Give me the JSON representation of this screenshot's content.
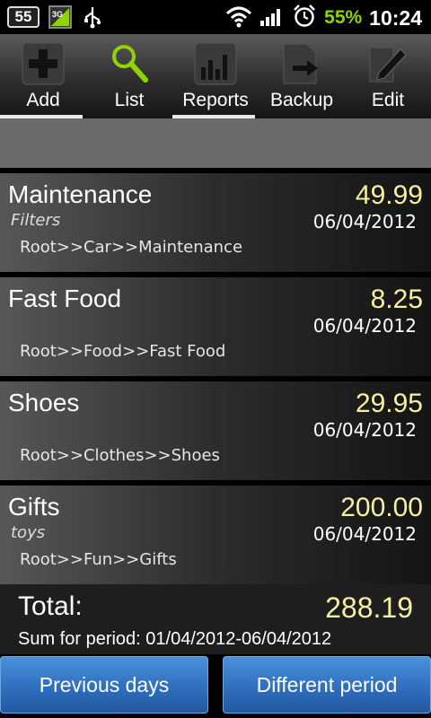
{
  "status_bar": {
    "notification_count": "55",
    "network_label": "3G",
    "battery_percent": "55%",
    "time": "10:24",
    "icons": [
      "notification-count-icon",
      "3g-icon",
      "usb-icon",
      "wifi-icon",
      "signal-icon",
      "alarm-icon"
    ]
  },
  "toolbar": {
    "items": [
      {
        "label": "Add",
        "icon": "plus-icon",
        "selected": true
      },
      {
        "label": "List",
        "icon": "search-icon",
        "selected": false
      },
      {
        "label": "Reports",
        "icon": "bar-chart-icon",
        "selected": true
      },
      {
        "label": "Backup",
        "icon": "export-icon",
        "selected": false
      },
      {
        "label": "Edit",
        "icon": "pencil-icon",
        "selected": false
      }
    ]
  },
  "items": [
    {
      "name": "Maintenance",
      "note": "Filters",
      "path": "Root>>Car>>Maintenance",
      "amount": "49.99",
      "date": "06/04/2012"
    },
    {
      "name": "Fast Food",
      "note": "",
      "path": "Root>>Food>>Fast Food",
      "amount": "8.25",
      "date": "06/04/2012"
    },
    {
      "name": "Shoes",
      "note": "",
      "path": "Root>>Clothes>>Shoes",
      "amount": "29.95",
      "date": "06/04/2012"
    },
    {
      "name": "Gifts",
      "note": "toys",
      "path": "Root>>Fun>>Gifts",
      "amount": "200.00",
      "date": "06/04/2012"
    }
  ],
  "total": {
    "label": "Total:",
    "value": "288.19",
    "period": "Sum for period: 01/04/2012-06/04/2012"
  },
  "buttons": {
    "previous": "Previous days",
    "different": "Different period"
  },
  "colors": {
    "amount": "#f6f0a0",
    "battery": "#8fd400",
    "button": "#2d6cbb"
  }
}
